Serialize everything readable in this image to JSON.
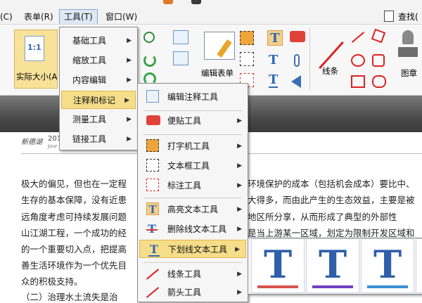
{
  "menubar": {
    "items": [
      {
        "label": "(C)"
      },
      {
        "label": "表单(R)"
      },
      {
        "label": "工具(T)"
      },
      {
        "label": "窗口(W)"
      }
    ],
    "search_label": "查找("
  },
  "ribbon": {
    "actual_size_glyph": "1:1",
    "actual_size_label": "实际大小(A",
    "edit_form_label": "编辑表单",
    "lines_label": "线条",
    "stamp_label": "图章"
  },
  "document": {
    "header_logo": "新德湖",
    "header_num": "201",
    "header_small": "Jour",
    "lines_left": [
      "极大的偏见，但也在一定程",
      "生存的基本保障，没有近患",
      "远角度考虑可持续发展问题",
      "山江湖工程，一个成功的经",
      "的一个重要切入点，把提高",
      "善生活环境作为一个优先目",
      "众的积极支持。",
      "（二）治理水土流失是治"
    ],
    "lines_right": [
      "环境保护的成本（包括机会成本）要比中、",
      "大得多，而由此产生的生态效益，主要是被",
      "地区所分享，从而形成了典型的外部性",
      "是当上游某一区域，划定为限制开发区域和"
    ]
  },
  "tools_menu": {
    "items": [
      {
        "label": "基础工具"
      },
      {
        "label": "缩放工具"
      },
      {
        "label": "内容编辑"
      },
      {
        "label": "注释和标记"
      },
      {
        "label": "测量工具"
      },
      {
        "label": "链接工具"
      }
    ]
  },
  "annot_menu": {
    "items": [
      {
        "label": "编辑注释工具"
      },
      {
        "label": "便贴工具"
      },
      {
        "label": "打字机工具"
      },
      {
        "label": "文本框工具"
      },
      {
        "label": "标注工具"
      },
      {
        "label": "高亮文本工具"
      },
      {
        "label": "删除线文本工具"
      },
      {
        "label": "下划线文本工具"
      },
      {
        "label": "线条工具"
      },
      {
        "label": "箭头工具"
      }
    ]
  },
  "underline_tiles": {
    "glyph": "T",
    "colors": [
      "#d9534f",
      "#6f3fc3",
      "#3a8fd6",
      "#cccccc"
    ]
  },
  "colors": {
    "highlight": "#f6dd8a",
    "tile_T": "#2f5fa9",
    "accent_blue": "#2f68b5"
  }
}
